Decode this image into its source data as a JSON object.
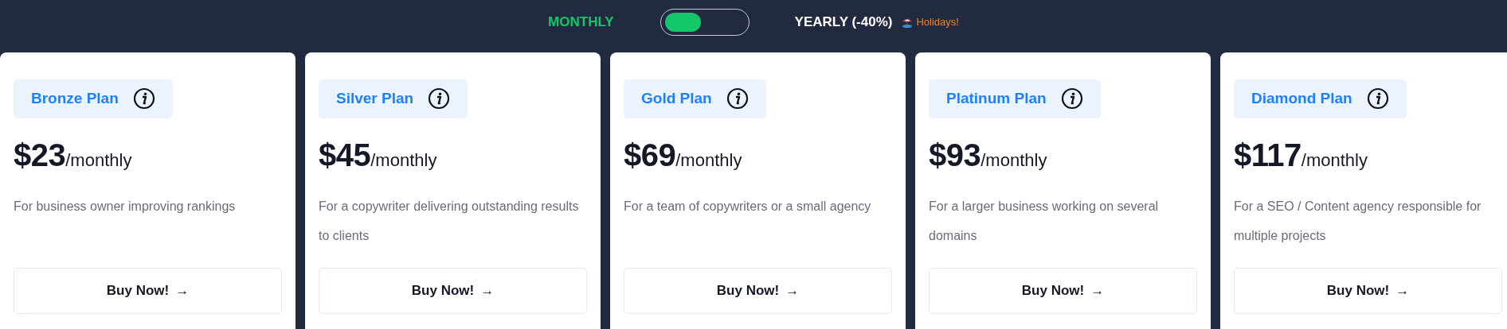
{
  "billing": {
    "options": [
      {
        "label": "MONTHLY",
        "selected": true
      },
      {
        "label": "YEARLY (-40%)",
        "selected": false
      }
    ],
    "toggle": {
      "on": false
    },
    "promo": "Holidays!"
  },
  "plans": [
    {
      "name": "Bronze Plan",
      "price": "$23",
      "period": "/monthly",
      "description": "For business owner improving rankings",
      "button": "Buy Now!",
      "arrow": "→"
    },
    {
      "name": "Silver Plan",
      "price": "$45",
      "period": "/monthly",
      "description": "For a copywriter delivering outstanding results to clients",
      "button": "Buy Now!",
      "arrow": "→"
    },
    {
      "name": "Gold Plan",
      "price": "$69",
      "period": "/monthly",
      "description": "For a team of copywriters or a small agency",
      "button": "Buy Now!",
      "arrow": "→"
    },
    {
      "name": "Platinum Plan",
      "price": "$93",
      "period": "/monthly",
      "description": "For a larger business working on several domains",
      "button": "Buy Now!",
      "arrow": "→"
    },
    {
      "name": "Diamond Plan",
      "price": "$117",
      "period": "/monthly",
      "description": "For a SEO / Content agency responsible for multiple projects",
      "button": "Buy Now!",
      "arrow": "→"
    }
  ]
}
